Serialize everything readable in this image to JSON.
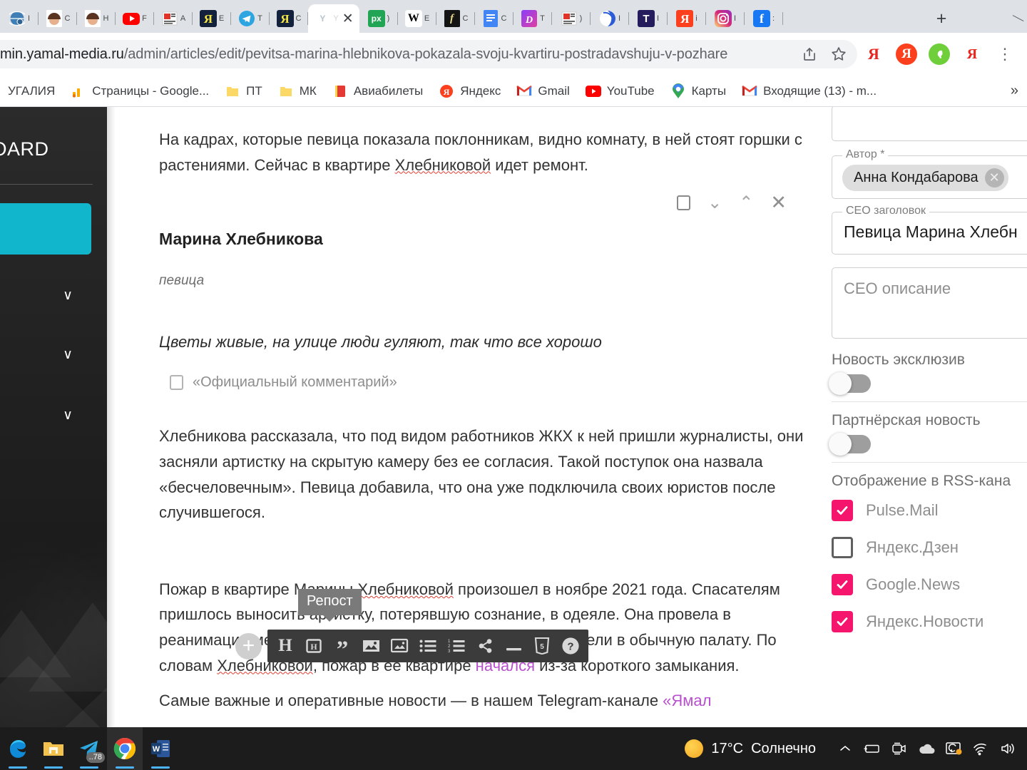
{
  "browser": {
    "tabs": [
      {
        "name": "tab-globe",
        "label": "I",
        "icon": "globe-icon",
        "bg": "#ffffff",
        "active": false
      },
      {
        "name": "tab-profile-1",
        "label": "C",
        "icon": "avatar-icon",
        "bg": "#e8b89a",
        "active": false
      },
      {
        "name": "tab-profile-2",
        "label": "H",
        "icon": "avatar-icon",
        "bg": "#e8b89a",
        "active": false
      },
      {
        "name": "tab-youtube",
        "label": "F",
        "icon": "youtube-icon",
        "bg": "#ff0000",
        "active": false
      },
      {
        "name": "tab-news",
        "label": "A",
        "icon": "news-icon",
        "bg": "#ffffff",
        "active": false
      },
      {
        "name": "tab-yandex-dark",
        "label": "E",
        "icon": "yandex-icon",
        "bg": "#14213d",
        "active": false
      },
      {
        "name": "tab-telegram",
        "label": "T",
        "icon": "telegram-icon",
        "bg": "#ffffff",
        "active": false
      },
      {
        "name": "tab-yandex-dark-2",
        "label": "C",
        "icon": "yandex-icon",
        "bg": "#14213d",
        "active": false
      },
      {
        "name": "tab-current",
        "label": "Y",
        "icon": "yamal-icon",
        "bg": "#ffffff",
        "active": true
      },
      {
        "name": "tab-px",
        "label": ")",
        "icon": "px-icon",
        "bg": "#21a453",
        "active": false
      },
      {
        "name": "tab-wikipedia",
        "label": "E",
        "icon": "wikipedia-icon",
        "bg": "#ffffff",
        "active": false
      },
      {
        "name": "tab-f",
        "label": "C",
        "icon": "f-icon",
        "bg": "#1a1a1a",
        "active": false
      },
      {
        "name": "tab-docs",
        "label": "C",
        "icon": "docs-icon",
        "bg": "#4285f4",
        "active": false
      },
      {
        "name": "tab-dzen",
        "label": "T",
        "icon": "dzen-icon",
        "bg": "#b04cd6",
        "active": false
      },
      {
        "name": "tab-news-2",
        "label": ")",
        "icon": "news-icon",
        "bg": "#ffffff",
        "active": false
      },
      {
        "name": "tab-blue-circle",
        "label": "I",
        "icon": "swirl-icon",
        "bg": "#ffffff",
        "active": false
      },
      {
        "name": "tab-tinkoff",
        "label": "I",
        "icon": "t-icon",
        "bg": "#241c5c",
        "active": false
      },
      {
        "name": "tab-yandex-red",
        "label": "i",
        "icon": "yandex-icon",
        "bg": "#fc3f1d",
        "active": false
      },
      {
        "name": "tab-instagram",
        "label": "I",
        "icon": "instagram-icon",
        "bg": "#ffffff",
        "active": false
      },
      {
        "name": "tab-facebook",
        "label": ":",
        "icon": "facebook-icon",
        "bg": "#1877f2",
        "active": false
      }
    ],
    "new_tab_label": "+",
    "close_label": "✕",
    "url_domain": "min.yamal-media.ru",
    "url_path": "/admin/articles/edit/pevitsa-marina-hlebnikova-pokazala-svoju-kvartiru-postradavshuju-v-pozhare",
    "omnibox_actions": [
      {
        "name": "share-icon",
        "glyph": "↱"
      },
      {
        "name": "bookmark-star-icon",
        "glyph": "☆"
      }
    ],
    "extensions": [
      {
        "name": "yandex-translate-extension",
        "type": "ya-letter"
      },
      {
        "name": "yandex-extension",
        "type": "ya-circle"
      },
      {
        "name": "green-shield-extension",
        "type": "green-circle"
      },
      {
        "name": "yandex-metrika-extension",
        "type": "ya-letter"
      },
      {
        "name": "chrome-menu-button",
        "type": "kebab"
      }
    ],
    "bookmarks": [
      {
        "name": "bookmark-portugal",
        "label": "УГАЛИЯ",
        "icon": "none"
      },
      {
        "name": "bookmark-google-pages",
        "label": "Страницы - Google...",
        "icon": "analytics-icon"
      },
      {
        "name": "bookmark-pt",
        "label": "ПТ",
        "icon": "folder-icon"
      },
      {
        "name": "bookmark-mk",
        "label": "МК",
        "icon": "folder-icon"
      },
      {
        "name": "bookmark-avia",
        "label": "Авиабилеты",
        "icon": "book-icon"
      },
      {
        "name": "bookmark-yandex",
        "label": "Яндекс",
        "icon": "yandex-icon"
      },
      {
        "name": "bookmark-gmail",
        "label": "Gmail",
        "icon": "gmail-icon"
      },
      {
        "name": "bookmark-youtube",
        "label": "YouTube",
        "icon": "youtube-icon"
      },
      {
        "name": "bookmark-maps",
        "label": "Карты",
        "icon": "maps-pin-icon"
      },
      {
        "name": "bookmark-inbox",
        "label": "Входящие (13) - m...",
        "icon": "gmail-icon"
      }
    ],
    "bookmarks_overflow": "»"
  },
  "admin": {
    "brand": "BOARD",
    "chevrons": [
      "∨",
      "∨",
      "∨"
    ]
  },
  "article": {
    "paragraph_1": "На кадрах, которые певица показала поклонникам, видно комнату, в ней стоят горшки с растениями. Сейчас в квартире ",
    "paragraph_1_misspelled": "Хлебниковой",
    "paragraph_1_tail": " идет ремонт.",
    "block_actions": [
      {
        "name": "block-select-checkbox",
        "glyph": ""
      },
      {
        "name": "move-down-icon",
        "glyph": "⌄"
      },
      {
        "name": "move-up-icon",
        "glyph": "⌃"
      },
      {
        "name": "delete-block-icon",
        "glyph": "✕"
      }
    ],
    "speaker_name": "Марина Хлебникова",
    "speaker_role": "певица",
    "quote_text": "Цветы живые, на улице люди гуляют, так что все хорошо",
    "official_comment_label": "«Официальный комментарий»",
    "paragraph_2": "Хлебникова рассказала, что под видом работников ЖКХ к ней пришли журналисты, они засняли артистку на скрытую камеру без ее согласия. Такой поступок она назвала «бесчеловечным». Певица добавила, что она уже подключила своих юристов после случившегося.",
    "paragraph_3_a": "Пожар в квартире Марины ",
    "paragraph_3_sp1": "Хлебниковой",
    "paragraph_3_b": " произошел в ноябре 2021 года. Спасателям пришлось выносить артистку, потерявшую сознание, в одеяле. Она провела в реанимации месяц, после чего 56-летнюю женщину перевели в обычную палату. По словам ",
    "paragraph_3_sp2": "Хлебниковой",
    "paragraph_3_c": ", пожар в ее квартире ",
    "paragraph_3_link": "начался",
    "paragraph_3_d": " из-за короткого замыкания.",
    "paragraph_4_a": "Самые важные и оперативные новости — в нашем Telegram-канале ",
    "paragraph_4_link": "«Ямал"
  },
  "editor_toolbar": {
    "tooltip": "Репост",
    "add_block_label": "+",
    "buttons": [
      {
        "name": "heading-h-button",
        "label": "H"
      },
      {
        "name": "heading-boxed-button",
        "label": "H"
      },
      {
        "name": "quote-button",
        "label": "”"
      },
      {
        "name": "image-button",
        "label": "image"
      },
      {
        "name": "gallery-button",
        "label": "gallery"
      },
      {
        "name": "bullet-list-button",
        "label": "bullets"
      },
      {
        "name": "numbered-list-button",
        "label": "numbers"
      },
      {
        "name": "share-repost-button",
        "label": "share"
      },
      {
        "name": "divider-button",
        "label": "divider"
      },
      {
        "name": "html-embed-button",
        "label": "html5"
      },
      {
        "name": "help-button",
        "label": "?"
      }
    ]
  },
  "form": {
    "author_legend": "Автор *",
    "author_chip": "Анна Кондабарова",
    "author_chip_remove": "✕",
    "seo_title_legend": "CEO заголовок",
    "seo_title_value": "Певица Марина Хлебн",
    "seo_desc_placeholder": "CEO описание",
    "exclusive_label": "Новость эксклюзив",
    "partner_label": "Партнёрская новость",
    "rss_title": "Отображение в RSS-кана",
    "rss_items": [
      {
        "label": "Pulse.Mail",
        "checked": true,
        "name": "rss-checkbox-pulse-mail"
      },
      {
        "label": "Яндекс.Дзен",
        "checked": false,
        "name": "rss-checkbox-yandex-dzen"
      },
      {
        "label": "Google.News",
        "checked": true,
        "name": "rss-checkbox-google-news"
      },
      {
        "label": "Яндекс.Новости",
        "checked": true,
        "name": "rss-checkbox-yandex-news"
      }
    ],
    "accent_checked": "#f5156c"
  },
  "taskbar": {
    "apps": [
      {
        "name": "taskbar-edge",
        "icon": "edge-icon",
        "active": false,
        "badge": ""
      },
      {
        "name": "taskbar-explorer",
        "icon": "folder-icon",
        "active": false,
        "badge": ""
      },
      {
        "name": "taskbar-telegram",
        "icon": "telegram-icon",
        "active": false,
        "badge": "..78"
      },
      {
        "name": "taskbar-chrome",
        "icon": "chrome-icon",
        "active": true,
        "badge": ""
      },
      {
        "name": "taskbar-word",
        "icon": "word-icon",
        "active": false,
        "badge": ""
      }
    ],
    "temperature": "17°C",
    "weather": "Солнечно",
    "tray": [
      {
        "name": "show-hidden-icons",
        "glyph": "⌃"
      },
      {
        "name": "battery-icon",
        "glyph": "battery"
      },
      {
        "name": "camera-icon",
        "glyph": "camera"
      },
      {
        "name": "onedrive-icon",
        "glyph": "cloud"
      },
      {
        "name": "sync-icon",
        "glyph": "sync"
      },
      {
        "name": "wifi-icon",
        "glyph": "wifi"
      },
      {
        "name": "volume-icon",
        "glyph": "speaker"
      }
    ]
  }
}
